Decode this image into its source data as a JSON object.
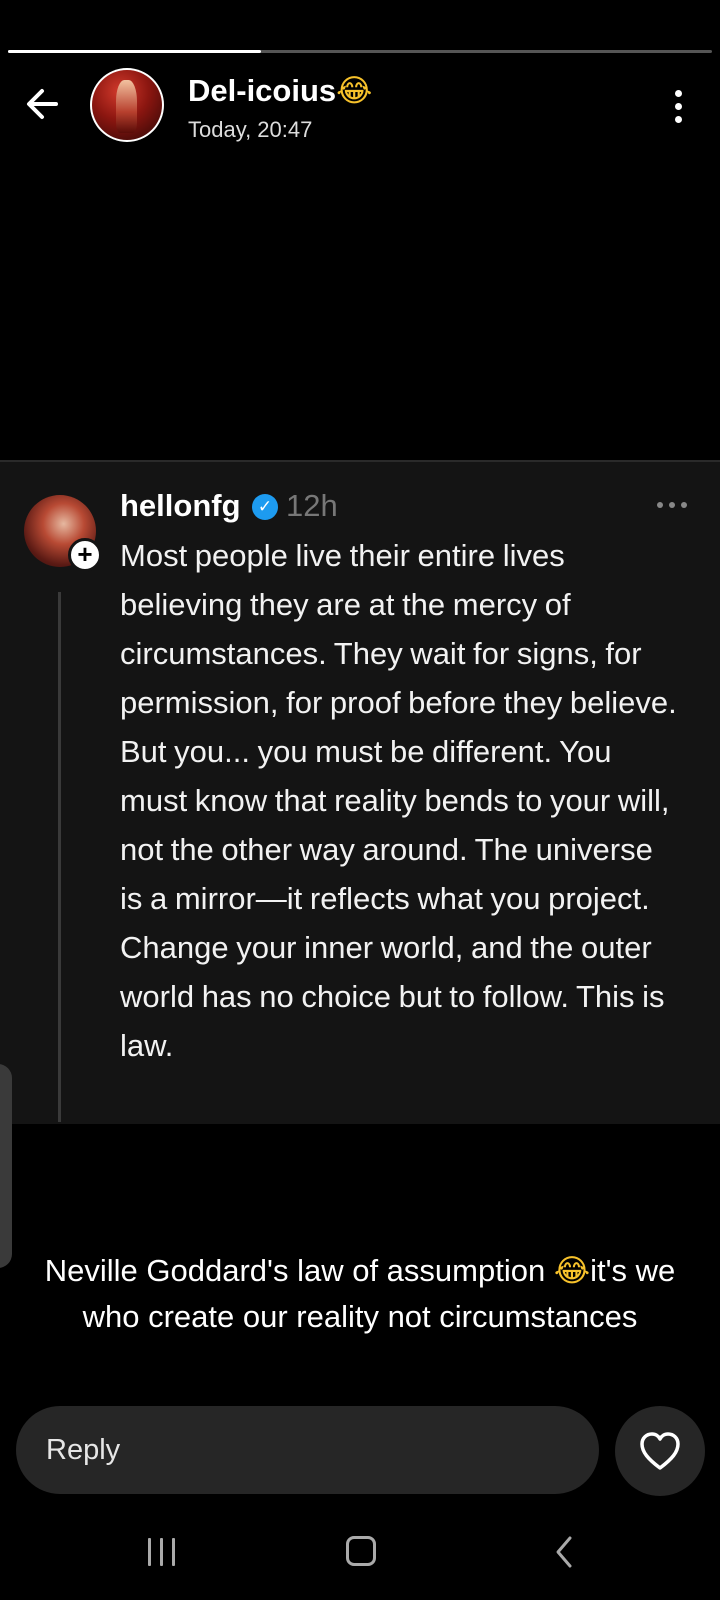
{
  "story": {
    "progress": 0.36
  },
  "header": {
    "name": "Del-icoius",
    "name_emoji": "😂",
    "timestamp": "Today, 20:47",
    "icons": {
      "back": "arrow-left-icon",
      "more": "more-vertical-icon"
    }
  },
  "post": {
    "username": "hellonfg",
    "verified": "✓",
    "time": "12h",
    "text": "Most people live their entire lives believing they are at the mercy of circumstances. They wait for signs, for permission, for proof before they believe. But you... you must be different. You must know that reality bends to your will, not the other way around. The universe is a mirror—it reflects what you project. Change your inner world, and the outer world has no choice but to follow. This is law.",
    "follow_symbol": "+",
    "colors": {
      "verified": "#1d9bf0"
    }
  },
  "caption": {
    "before_emoji": "Neville Goddard's law of assumption ",
    "emoji": "😂",
    "after_emoji": "it's we who create our reality not circumstances"
  },
  "reply": {
    "placeholder": "Reply",
    "like_icon": "heart-outline-icon"
  },
  "system_nav": {
    "icons": [
      "recent-apps-icon",
      "home-icon",
      "back-icon"
    ]
  }
}
